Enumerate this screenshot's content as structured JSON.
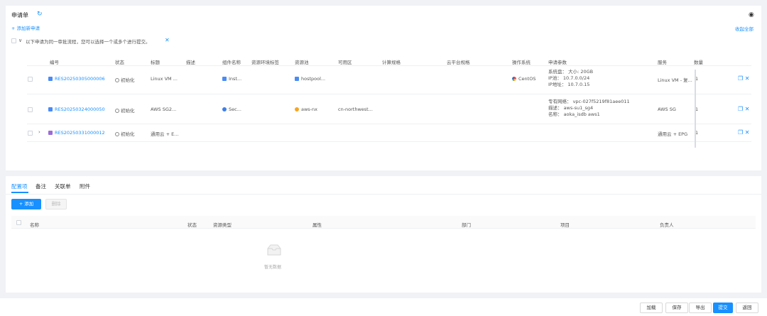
{
  "top": {
    "title": "申请单",
    "add_label": "+ 添加新申请",
    "notice": "以下申请为同一审批流程，您可以选择一个或多个进行提交。",
    "collapse_all": "收起全部",
    "headers": [
      "编号",
      "状态",
      "标题",
      "描述",
      "组件名称",
      "资源环境标签",
      "资源池",
      "可用区",
      "计算规格",
      "云平台规格",
      "操作系统",
      "申请参数",
      "服务",
      "数量"
    ]
  },
  "rows": [
    {
      "id": "RES20250305000006",
      "status": "初始化",
      "title": "Linux VM ...",
      "component": "Inst...",
      "pool": "hostpool...",
      "zone": "",
      "os": "CentOS",
      "params": [
        "系统盘：  大小: 20GB",
        "IP池：  10.7.0.0/24",
        "IP地址：  10.7.0.15"
      ],
      "service": "Linux VM - 复...",
      "qty": "1"
    },
    {
      "id": "RES20250324000050",
      "status": "初始化",
      "title": "AWS SG2...",
      "component": "Sec...",
      "pool": "aws-nx",
      "zone": "cn-northwest...",
      "os": "",
      "params": [
        "专有网络：  vpc-027f5219f81aee011",
        "描述：  aws-su1_sg4",
        "名称：  aoka_isdb aws1"
      ],
      "service": "AWS SG",
      "qty": "1"
    },
    {
      "id": "RES20250331000012",
      "status": "初始化",
      "title": "通用云 + E...",
      "component": "",
      "pool": "",
      "zone": "",
      "os": "",
      "params": [],
      "service": "通用云 + EPG",
      "qty": "1"
    }
  ],
  "bottom": {
    "tabs": [
      "配置项",
      "备注",
      "关联单",
      "附件"
    ],
    "add_button": "+ 添加",
    "delete_button": "删除",
    "headers": [
      "名称",
      "状态",
      "资源类型",
      "属性",
      "部门",
      "项目",
      "负责人"
    ],
    "empty_text": "暂无数据"
  },
  "footer": {
    "buttons": [
      "加载",
      "保存",
      "导出",
      "提交",
      "返回"
    ]
  },
  "colors": {
    "accent": "#1890ff",
    "purple": "#9b6cd8"
  }
}
